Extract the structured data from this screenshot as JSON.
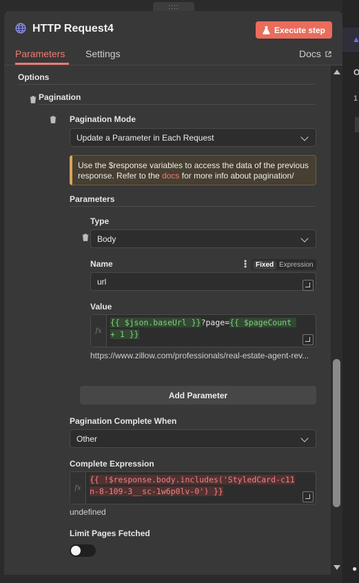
{
  "header": {
    "title": "HTTP Request4",
    "execute_label": "Execute step",
    "icon": "globe-icon"
  },
  "tabs": [
    {
      "label": "Parameters",
      "active": true
    },
    {
      "label": "Settings",
      "active": false
    }
  ],
  "docs_label": "Docs",
  "drag_handle": "::::",
  "section_options": "Options",
  "pagination": {
    "label": "Pagination",
    "mode_label": "Pagination Mode",
    "mode_value": "Update a Parameter in Each Request",
    "callout": {
      "before": "Use the $response variables to access the data of the previous response. Refer to the ",
      "link": "docs",
      "after": " for more info about pagination/"
    },
    "parameters_label": "Parameters",
    "param": {
      "type_label": "Type",
      "type_value": "Body",
      "name_label": "Name",
      "name_value": "url",
      "fixed_label": "Fixed",
      "expression_label": "Expression",
      "value_label": "Value",
      "value_expr": {
        "t1": "{{ $json.baseUrl }}",
        "t2": "?page=",
        "t3": "{{ $pageCount + 1 }}"
      },
      "fx_label": "fx",
      "preview": "https://www.zillow.com/professionals/real-estate-agent-rev..."
    },
    "add_param_label": "Add Parameter",
    "complete_when_label": "Pagination Complete When",
    "complete_when_value": "Other",
    "complete_expr_label": "Complete Expression",
    "complete_expr": "{{ !$response.body.includes('StyledCard-c11n-8-109-3__sc-1w6p0lv-0') }}",
    "complete_result": "undefined",
    "limit_label": "Limit Pages Fetched",
    "limit_enabled": false
  },
  "background": {
    "letter": "O",
    "digit": "1"
  },
  "colors": {
    "accent": "#ea6c5b",
    "tab_active": "#ef7c6d",
    "callout_border": "#d9a55a"
  }
}
